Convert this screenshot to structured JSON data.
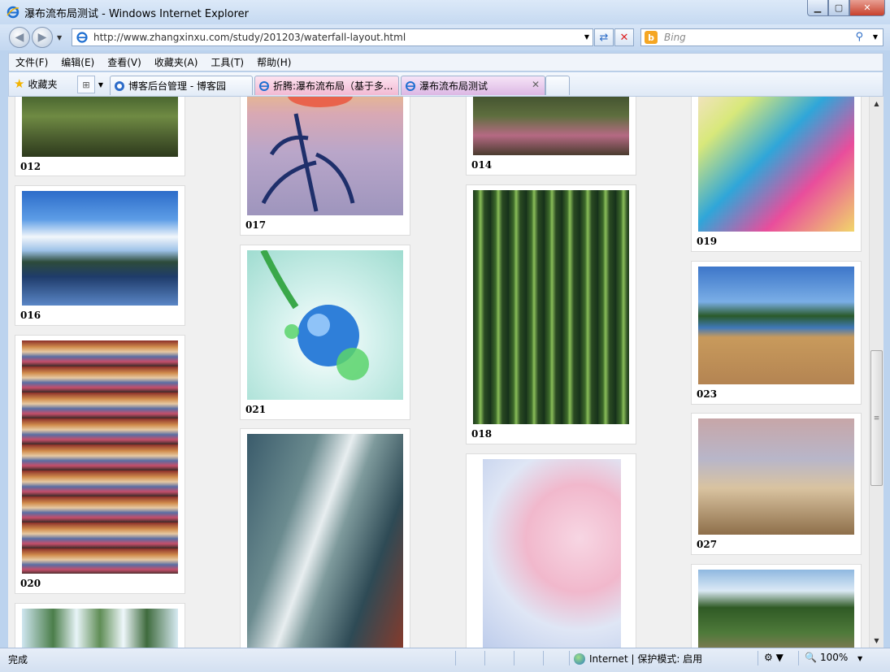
{
  "window": {
    "title": "瀑布流布局测试 - Windows Internet Explorer"
  },
  "address": {
    "url": "http://www.zhangxinxu.com/study/201203/waterfall-layout.html"
  },
  "search": {
    "placeholder": "Bing"
  },
  "menu": {
    "items": [
      "文件(F)",
      "编辑(E)",
      "查看(V)",
      "收藏夹(A)",
      "工具(T)",
      "帮助(H)"
    ]
  },
  "favorites": {
    "label": "收藏夹"
  },
  "tabs": [
    {
      "label": "博客后台管理 - 博客园"
    },
    {
      "label": "折腾:瀑布流布局（基于多..."
    },
    {
      "label": "瀑布流布局测试"
    }
  ],
  "cards": [
    {
      "caption": "012"
    },
    {
      "caption": "016"
    },
    {
      "caption": "020"
    },
    {
      "caption": ""
    },
    {
      "caption": "017"
    },
    {
      "caption": "021"
    },
    {
      "caption": ""
    },
    {
      "caption": "014"
    },
    {
      "caption": "018"
    },
    {
      "caption": ""
    },
    {
      "caption": "019"
    },
    {
      "caption": "023"
    },
    {
      "caption": "027"
    },
    {
      "caption": ""
    }
  ],
  "status": {
    "left": "完成",
    "zone": "Internet | 保护模式: 启用",
    "zoom": "100%"
  },
  "colors": {
    "title_bar": "#c5d9f1",
    "content_bg": "#f0f0f0",
    "card_bg": "#ffffff"
  }
}
